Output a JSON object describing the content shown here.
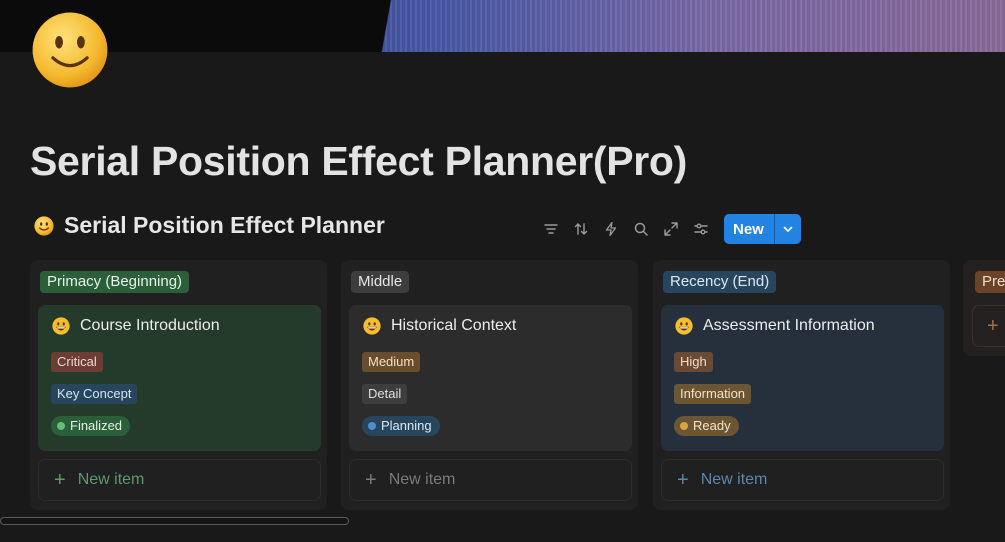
{
  "page": {
    "title": "Serial Position Effect Planner(Pro)",
    "icon": "slightly-smiling-face-emoji"
  },
  "database": {
    "title": "Serial Position Effect Planner",
    "icon": "slightly-smiling-face-emoji",
    "toolbar": {
      "icons": [
        "filter-icon",
        "sort-icon",
        "automation-icon",
        "search-icon",
        "expand-icon",
        "settings-icon"
      ],
      "new_label": "New"
    }
  },
  "columns": [
    {
      "label": "Primacy (Beginning)",
      "header_color": "#2b5f3a",
      "card_bg": "#243a2a",
      "card": {
        "title": "Course Introduction",
        "icon": "grinning-face-emoji",
        "tags": [
          {
            "text": "Critical",
            "bg": "#6b3d34"
          },
          {
            "text": "Key Concept",
            "bg": "#27465e"
          }
        ],
        "status": {
          "text": "Finalized",
          "bg": "#2b5f3a",
          "dot": "#5fbf7c"
        }
      },
      "new_item_label": "New item",
      "new_item_color": "#5c9a6b"
    },
    {
      "label": "Middle",
      "header_color": "#3d3d3d",
      "card_bg": "#2c2c2c",
      "card": {
        "title": "Historical Context",
        "icon": "grinning-face-emoji",
        "tags": [
          {
            "text": "Medium",
            "bg": "#6a4d2c"
          },
          {
            "text": "Detail",
            "bg": "#3e3e3e"
          }
        ],
        "status": {
          "text": "Planning",
          "bg": "#27465e",
          "dot": "#4d8fce"
        }
      },
      "new_item_label": "New item",
      "new_item_color": "#7a7a7a"
    },
    {
      "label": "Recency (End)",
      "header_color": "#27465e",
      "card_bg": "#25303c",
      "card": {
        "title": "Assessment Information",
        "icon": "grinning-face-emoji",
        "tags": [
          {
            "text": "High",
            "bg": "#6a4a34"
          },
          {
            "text": "Information",
            "bg": "#6b5532"
          }
        ],
        "status": {
          "text": "Ready",
          "bg": "#6b5532",
          "dot": "#d8a640"
        }
      },
      "new_item_label": "New item",
      "new_item_color": "#5a87b0"
    },
    {
      "label": "Pre",
      "header_color": "#6a4328",
      "card_bg": "#2b2622",
      "new_item_color": "#a07050"
    }
  ]
}
